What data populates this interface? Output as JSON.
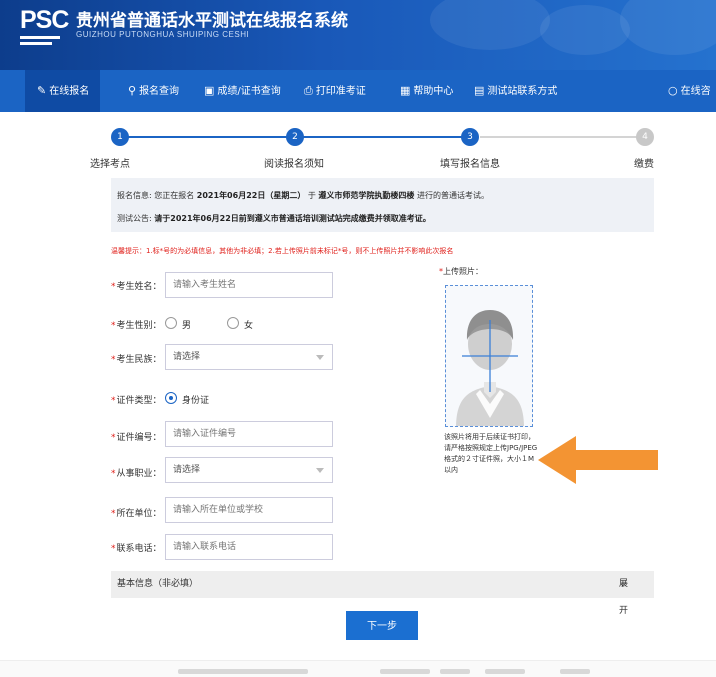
{
  "header": {
    "logo": "PSC",
    "title": "贵州省普通话水平测试在线报名系统",
    "subtitle": "GUIZHOU PUTONGHUA SHUIPING CESHI"
  },
  "nav": {
    "items": [
      {
        "label": "在线报名",
        "icon": "edit-icon"
      },
      {
        "label": "报名查询",
        "icon": "search-icon"
      },
      {
        "label": "成绩/证书查询",
        "icon": "certificate-search-icon"
      },
      {
        "label": "打印准考证",
        "icon": "printer-icon"
      },
      {
        "label": "帮助中心",
        "icon": "help-icon"
      },
      {
        "label": "测试站联系方式",
        "icon": "contact-icon"
      },
      {
        "label": "在线咨",
        "icon": "chat-icon"
      }
    ]
  },
  "steps": [
    {
      "num": "1",
      "label": "选择考点"
    },
    {
      "num": "2",
      "label": "阅读报名须知"
    },
    {
      "num": "3",
      "label": "填写报名信息"
    },
    {
      "num": "4",
      "label": "缴费"
    }
  ],
  "notice": {
    "line1_prefix": "报名信息: 您正在报名",
    "line1_date": "2021年06月22日（星期二）",
    "line1_mid": "于",
    "line1_place": "遵义市师范学院执勤楼四楼",
    "line1_suffix": "进行的普通话考试。",
    "line2_prefix": "测试公告:",
    "line2_text": "请于2021年06月22日前到遵义市普通话培训测试站完成缴费并领取准考证。"
  },
  "warning": "温馨提示：1.标*号的为必填信息，其他为非必填；2.若上传照片前未标记*号，则不上传照片并不影响此次报名",
  "form": {
    "name_label": "考生姓名：",
    "name_placeholder": "请输入考生姓名",
    "gender_label": "考生性别：",
    "gender_male": "男",
    "gender_female": "女",
    "ethnicity_label": "考生民族：",
    "ethnicity_value": "请选择",
    "idtype_label": "证件类型：",
    "idtype_value": "身份证",
    "idnum_label": "证件编号：",
    "idnum_placeholder": "请输入证件编号",
    "job_label": "从事职业：",
    "job_value": "请选择",
    "unit_label": "所在单位：",
    "unit_placeholder": "请输入所在单位或学校",
    "phone_label": "联系电话：",
    "phone_placeholder": "请输入联系电话"
  },
  "photo": {
    "label": "上传照片：",
    "hint": "该照片将用于后续证书打印，请严格按照规定上传JPG/JPEG格式的２寸证件照，大小１M以内"
  },
  "basic": {
    "label": "基本信息（非必填）",
    "toggle": "展开"
  },
  "next_button": "下一步",
  "colors": {
    "primary": "#1b64c4",
    "nav_active": "#0f4ba4",
    "required": "#e0201b",
    "arrow": "#f39433",
    "step_done": "#1b64c4",
    "step_todo": "#c8c8c8"
  }
}
